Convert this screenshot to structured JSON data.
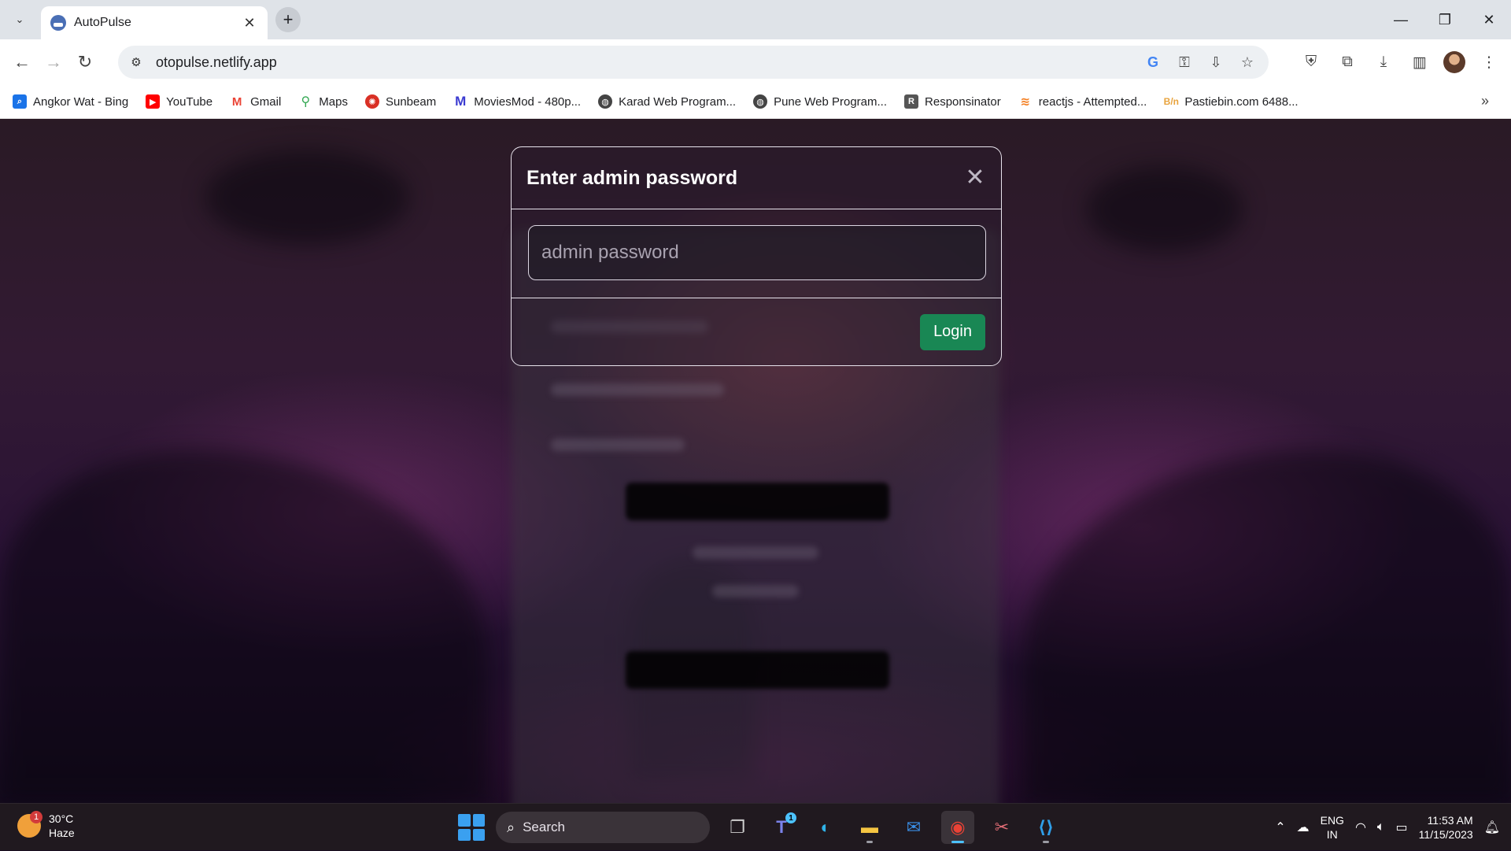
{
  "browser": {
    "tab_title": "AutoPulse",
    "url": "otopulse.netlify.app",
    "bookmarks": [
      {
        "label": "Angkor Wat - Bing",
        "icon": "search-icon",
        "color": "#1a73e8"
      },
      {
        "label": "YouTube",
        "icon": "youtube-icon",
        "color": "#ff0000"
      },
      {
        "label": "Gmail",
        "icon": "gmail-icon",
        "color": "#ea4335"
      },
      {
        "label": "Maps",
        "icon": "maps-icon",
        "color": "#34a853"
      },
      {
        "label": "Sunbeam",
        "icon": "sunbeam-icon",
        "color": "#d93025"
      },
      {
        "label": "MoviesMod - 480p...",
        "icon": "moviesmod-icon",
        "color": "#3b3bd1"
      },
      {
        "label": "Karad Web Program...",
        "icon": "globe-icon",
        "color": "#444444"
      },
      {
        "label": "Pune Web Program...",
        "icon": "globe-icon",
        "color": "#444444"
      },
      {
        "label": "Responsinator",
        "icon": "responsinator-icon",
        "color": "#555555"
      },
      {
        "label": "reactjs - Attempted...",
        "icon": "stackoverflow-icon",
        "color": "#f48024"
      },
      {
        "label": "Pastiebin.com 6488...",
        "icon": "pastebin-icon",
        "color": "#e8a33d"
      }
    ]
  },
  "modal": {
    "title": "Enter admin password",
    "input_placeholder": "admin password",
    "input_value": "",
    "login_label": "Login",
    "login_color": "#198754"
  },
  "taskbar": {
    "weather_temp": "30°C",
    "weather_desc": "Haze",
    "weather_badge": "1",
    "search_label": "Search",
    "teams_badge": "1",
    "lang_line1": "ENG",
    "lang_line2": "IN",
    "time": "11:53 AM",
    "date": "11/15/2023"
  }
}
